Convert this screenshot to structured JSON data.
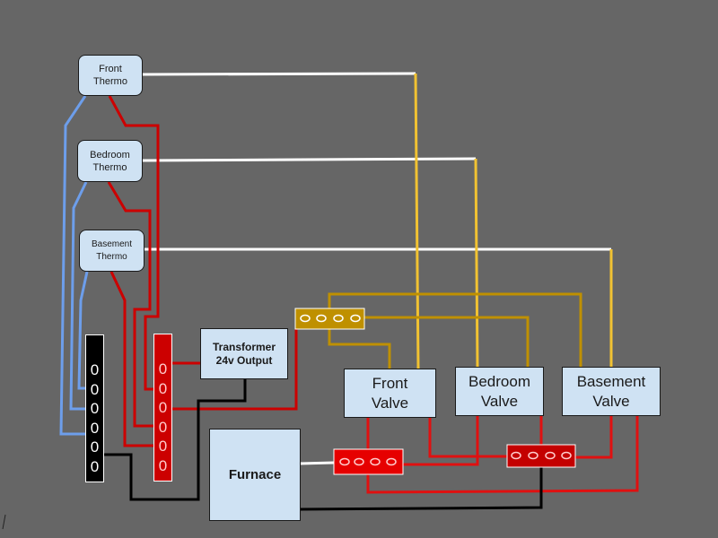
{
  "thermostats": [
    {
      "line1": "Front",
      "line2": "Thermo"
    },
    {
      "line1": "Bedroom",
      "line2": "Thermo"
    },
    {
      "line1": "Basement",
      "line2": "Thermo"
    }
  ],
  "valves": [
    {
      "line1": "Front",
      "line2": "Valve"
    },
    {
      "line1": "Bedroom",
      "line2": "Valve"
    },
    {
      "line1": "Basement",
      "line2": "Valve"
    }
  ],
  "transformer": {
    "line1": "Transformer",
    "line2": "24v Output"
  },
  "furnace": {
    "label": "Furnace"
  },
  "black_strip": {
    "terminals": [
      "0",
      "0",
      "0",
      "0",
      "0",
      "0"
    ]
  },
  "red_strip": {
    "terminals": [
      "0",
      "0",
      "0",
      "0",
      "0",
      "0"
    ]
  },
  "colors": {
    "background": "#666666",
    "box_fill": "#cfe2f3",
    "common_wire": "#6d9eeb",
    "power_wire": "#cc0000",
    "signal_wire": "#ffffff",
    "valve_wire": "#f1c232",
    "gold_connector": "#bf9000",
    "ground_wire": "#000000"
  }
}
